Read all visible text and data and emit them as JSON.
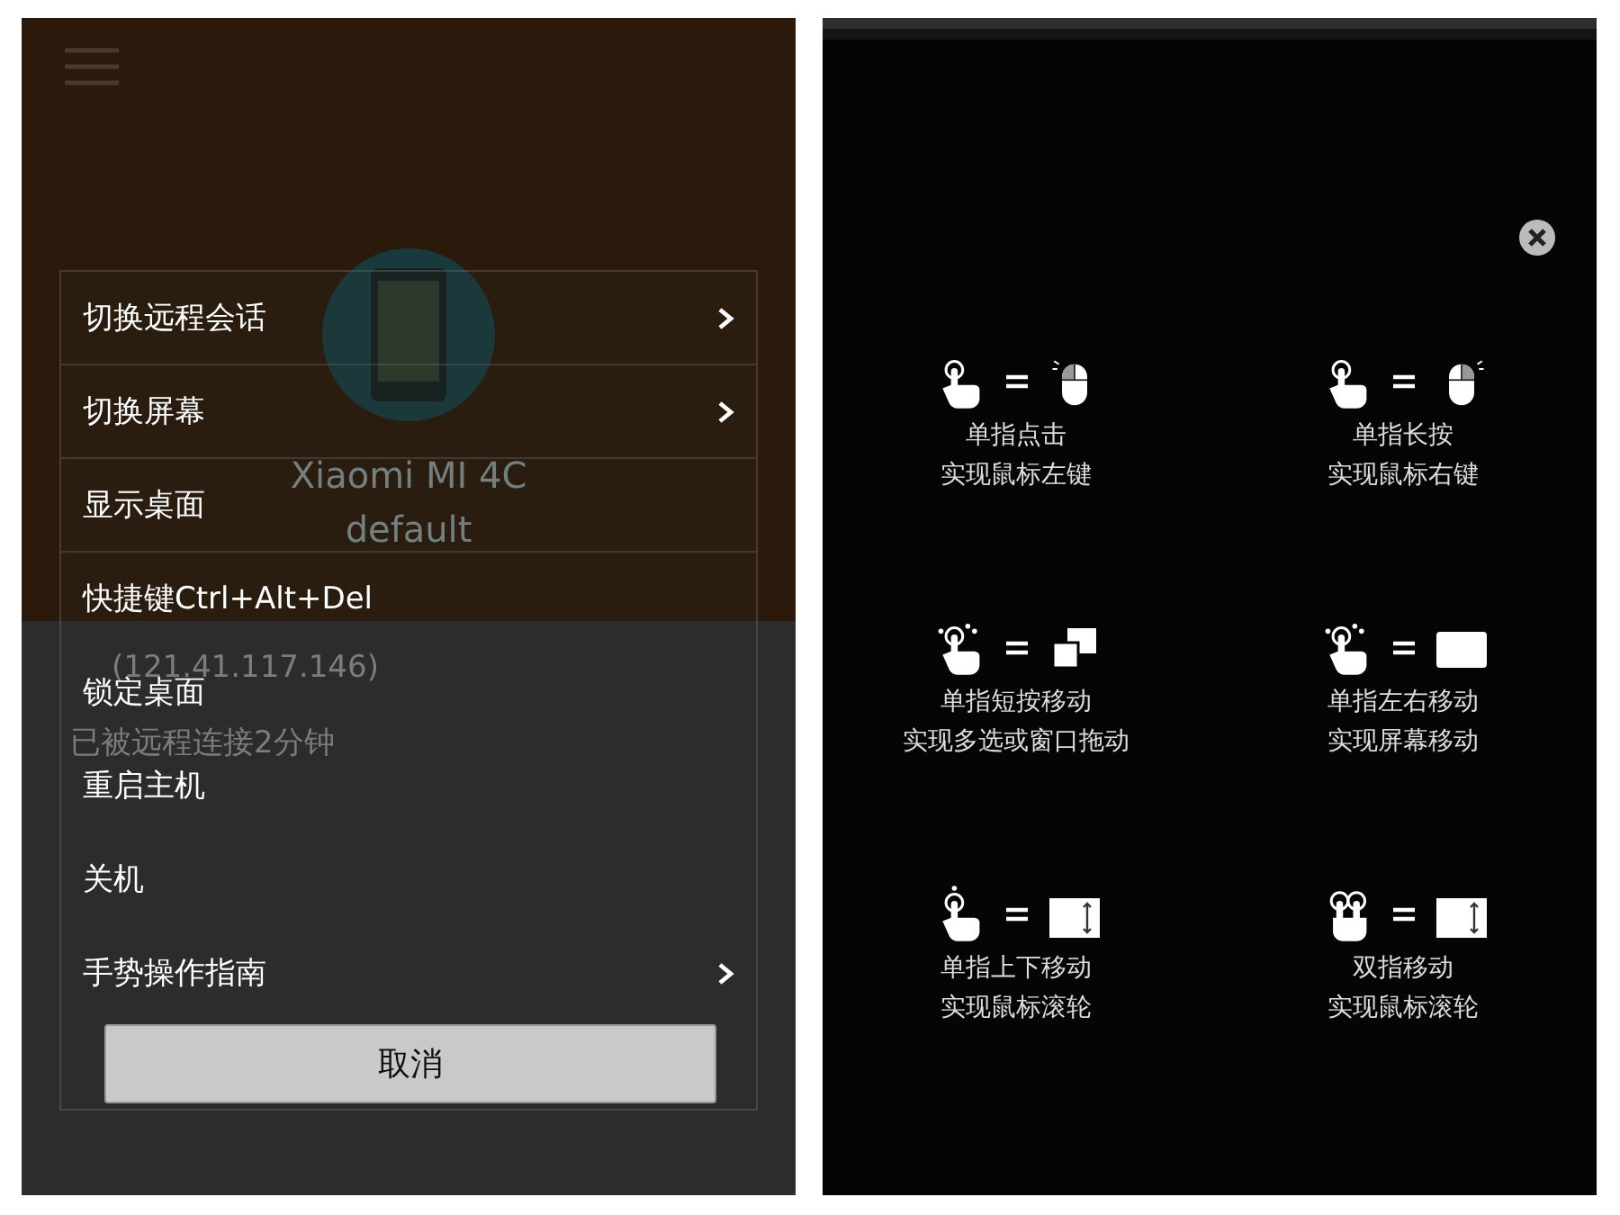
{
  "left_screen": {
    "device": {
      "name": "Xiaomi MI 4C",
      "group": "default",
      "address": "(121.41.117.146)",
      "status": "已被远程连接2分钟"
    },
    "menu": {
      "items": [
        {
          "label": "切换远程会话",
          "has_submenu": true
        },
        {
          "label": "切换屏幕",
          "has_submenu": true
        },
        {
          "label": "显示桌面",
          "has_submenu": false
        },
        {
          "label": "快捷键Ctrl+Alt+Del",
          "has_submenu": false
        },
        {
          "label": "锁定桌面",
          "has_submenu": false
        },
        {
          "label": "重启主机",
          "has_submenu": false
        },
        {
          "label": "关机",
          "has_submenu": false
        },
        {
          "label": "手势操作指南",
          "has_submenu": true
        }
      ],
      "cancel_button": "取消"
    }
  },
  "right_screen": {
    "gestures": [
      {
        "kind": "tap",
        "lines": [
          "单指点击",
          "实现鼠标左键"
        ]
      },
      {
        "kind": "long-press",
        "lines": [
          "单指长按",
          "实现鼠标右键"
        ]
      },
      {
        "kind": "drag",
        "lines": [
          "单指短按移动",
          "实现多选或窗口拖动"
        ]
      },
      {
        "kind": "pan",
        "lines": [
          "单指左右移动",
          "实现屏幕移动"
        ]
      },
      {
        "kind": "scroll",
        "lines": [
          "单指上下移动",
          "实现鼠标滚轮"
        ]
      },
      {
        "kind": "two-finger-scroll",
        "lines": [
          "双指移动",
          "实现鼠标滚轮"
        ]
      }
    ]
  }
}
